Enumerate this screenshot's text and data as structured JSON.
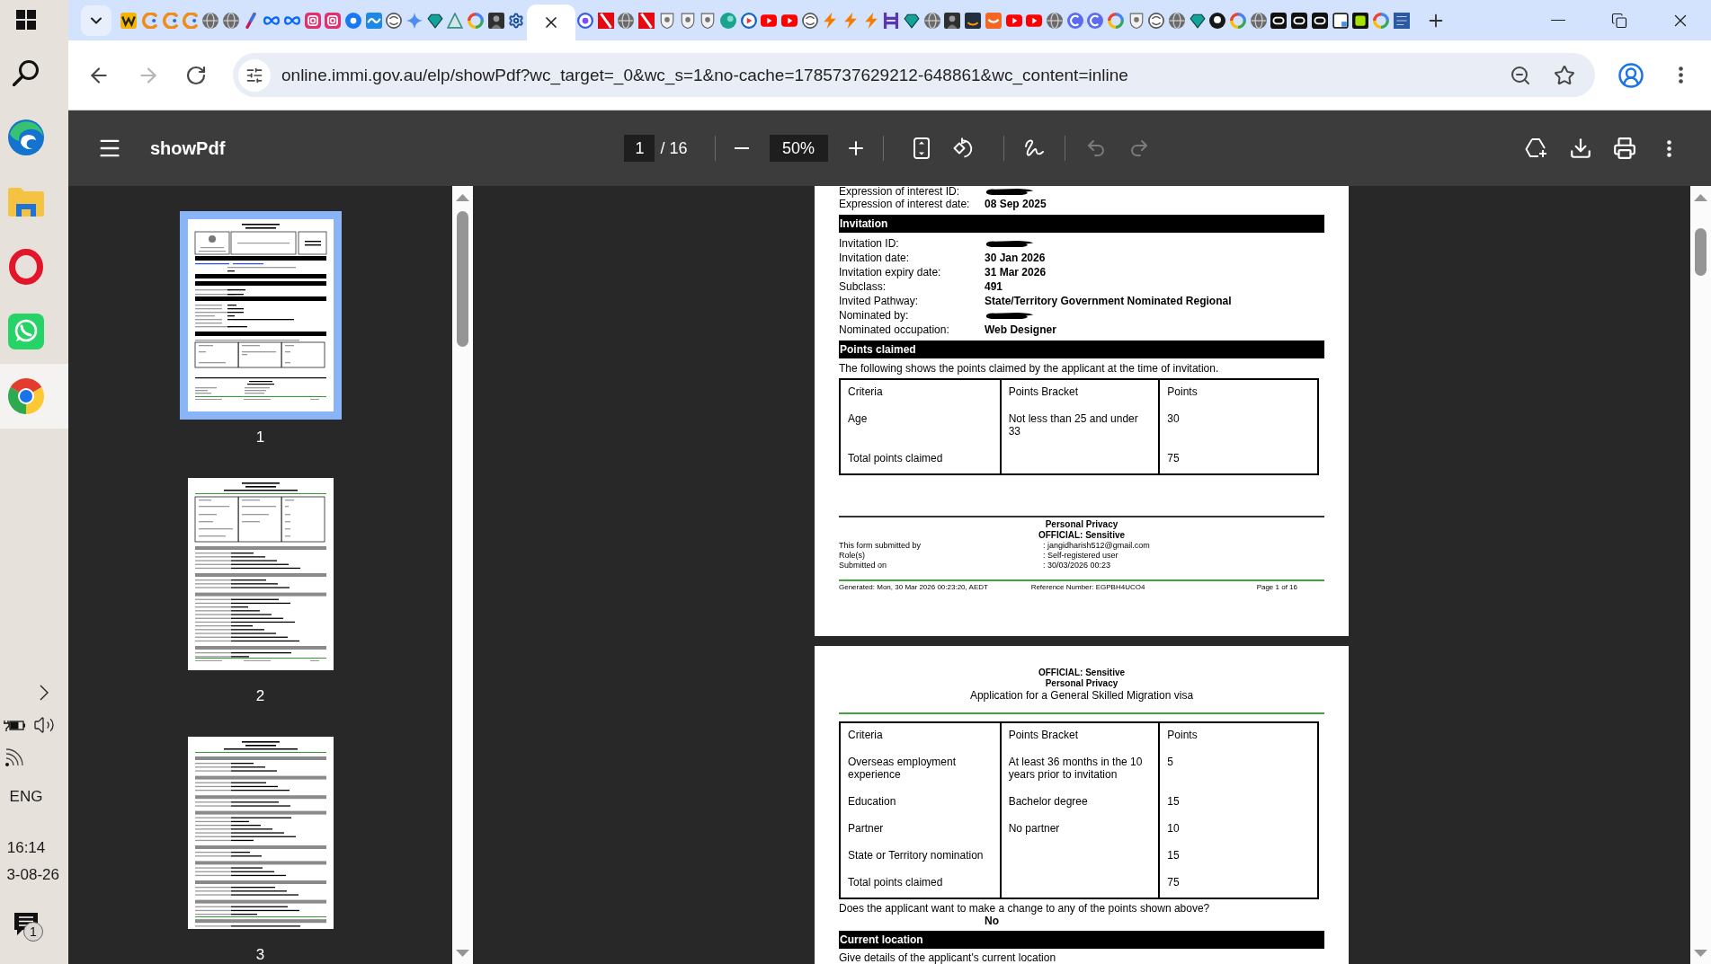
{
  "taskbar": {
    "apps": [
      {
        "selected": false
      },
      {
        "selected": false
      },
      {
        "selected": false
      },
      {
        "selected": false
      },
      {
        "selected": true
      }
    ],
    "tray": {
      "language": "ENG",
      "time": "16:14",
      "date": "3-08-26",
      "notification_count": "1"
    }
  },
  "browser": {
    "tabs": [
      {
        "selected": false
      },
      {
        "selected": false
      },
      {
        "selected": false
      },
      {
        "selected": false
      },
      {
        "selected": false
      },
      {
        "selected": false
      },
      {
        "selected": false
      },
      {
        "selected": false
      },
      {
        "selected": false
      },
      {
        "selected": false
      },
      {
        "selected": false
      },
      {
        "selected": false
      },
      {
        "selected": false
      },
      {
        "selected": false
      },
      {
        "selected": false
      },
      {
        "selected": false
      },
      {
        "selected": false
      },
      {
        "selected": false
      },
      {
        "selected": false
      },
      {
        "selected": false
      },
      {
        "selected": true
      },
      {
        "selected": false
      },
      {
        "selected": false
      },
      {
        "selected": false
      },
      {
        "selected": false
      },
      {
        "selected": false
      },
      {
        "selected": false
      },
      {
        "selected": false
      },
      {
        "selected": false
      },
      {
        "selected": false
      },
      {
        "selected": false
      },
      {
        "selected": false
      },
      {
        "selected": false
      },
      {
        "selected": false
      },
      {
        "selected": false
      },
      {
        "selected": false
      },
      {
        "selected": false
      },
      {
        "selected": false
      },
      {
        "selected": false
      },
      {
        "selected": false
      },
      {
        "selected": false
      },
      {
        "selected": false
      },
      {
        "selected": false
      },
      {
        "selected": false
      },
      {
        "selected": false
      },
      {
        "selected": false
      },
      {
        "selected": false
      },
      {
        "selected": false
      },
      {
        "selected": false
      },
      {
        "selected": false
      },
      {
        "selected": false
      },
      {
        "selected": false
      },
      {
        "selected": false
      },
      {
        "selected": false
      },
      {
        "selected": false
      },
      {
        "selected": false
      },
      {
        "selected": false
      },
      {
        "selected": false
      },
      {
        "selected": false
      },
      {
        "selected": false
      },
      {
        "selected": false
      },
      {
        "selected": false
      }
    ],
    "url": "online.immi.gov.au/elp/showPdf?wc_target=_0&wc_s=1&no-cache=1785737629212-648861&wc_content=inline",
    "forward_disabled": true
  },
  "pdf_viewer": {
    "toolbar": {
      "title": "showPdf",
      "page": "1",
      "page_count": "/ 16",
      "zoom": "50%",
      "undo_disabled": true,
      "redo_disabled": true
    },
    "thumbnails": [
      {
        "label": "1",
        "selected": true
      },
      {
        "label": "2",
        "selected": false
      },
      {
        "label": "3",
        "selected": false
      }
    ],
    "pages": [
      {
        "blocks": [
          {
            "kind": "field",
            "label": "Expression of interest ID:",
            "redacted": true
          },
          {
            "kind": "field",
            "label": "Expression of interest date:",
            "value": "08 Sep 2025",
            "redacted": false
          },
          {
            "kind": "heading",
            "text": "Invitation"
          },
          {
            "kind": "field",
            "label": "Invitation ID:",
            "redacted": true
          },
          {
            "kind": "field",
            "label": "Invitation date:",
            "value": "30 Jan 2026",
            "redacted": false
          },
          {
            "kind": "field",
            "label": "Invitation expiry date:",
            "value": "31 Mar 2026",
            "redacted": false
          },
          {
            "kind": "field",
            "label": "Subclass:",
            "value": "491",
            "redacted": false
          },
          {
            "kind": "field",
            "label": "Invited Pathway:",
            "value": "State/Territory Government Nominated Regional",
            "redacted": false
          },
          {
            "kind": "field",
            "label": "Nominated by:",
            "redacted": true
          },
          {
            "kind": "field",
            "label": "Nominated occupation:",
            "value": "Web Designer",
            "redacted": false
          },
          {
            "kind": "heading",
            "text": "Points claimed"
          },
          {
            "kind": "paragraph",
            "text": "The following shows the points claimed by the applicant at the time of invitation."
          },
          {
            "kind": "table",
            "columns": [
              "Criteria",
              "Points Bracket",
              "Points"
            ],
            "rows": [
              {
                "criteria": "Age",
                "bracket": "Not less than 25 and under 33",
                "points": "30"
              },
              {
                "criteria": "Total points claimed",
                "points": "75"
              }
            ]
          }
        ],
        "footer": {
          "marks": [
            "Personal Privacy",
            "OFFICIAL: Sensitive"
          ],
          "submission": [
            {
              "label": "This form submitted by",
              "value": ": jangidharish512@gmail.com"
            },
            {
              "label": "Role(s)",
              "value": ": Self-registered user"
            },
            {
              "label": "Submitted on",
              "value": ": 30/03/2026 00:23"
            }
          ],
          "generated": "Generated: Mon, 30 Mar 2026 00:23:20, AEDT",
          "reference": "Reference Number: EGPBH4UCO4",
          "page_number": "Page 1 of 16"
        }
      },
      {
        "header": {
          "marks": [
            "OFFICIAL: Sensitive",
            "Personal Privacy"
          ],
          "title": "Application for a General Skilled Migration visa"
        },
        "blocks": [
          {
            "kind": "table",
            "columns": [
              "Criteria",
              "Points Bracket",
              "Points"
            ],
            "rows": [
              {
                "criteria": "Overseas employment experience",
                "bracket": "At least 36 months in the 10 years prior to invitation",
                "points": "5"
              },
              {
                "criteria": "Education",
                "bracket": "Bachelor degree",
                "points": "15"
              },
              {
                "criteria": "Partner",
                "bracket": "No partner",
                "points": "10"
              },
              {
                "criteria": "State or Territory nomination",
                "points": "15"
              },
              {
                "criteria": "Total points claimed",
                "points": "75"
              }
            ]
          },
          {
            "kind": "question",
            "text": "Does the applicant want to make a change to any of the points shown above?",
            "answer": "No"
          },
          {
            "kind": "heading",
            "text": "Current location"
          },
          {
            "kind": "paragraph",
            "text": "Give details of the applicant's current location"
          }
        ]
      }
    ]
  }
}
